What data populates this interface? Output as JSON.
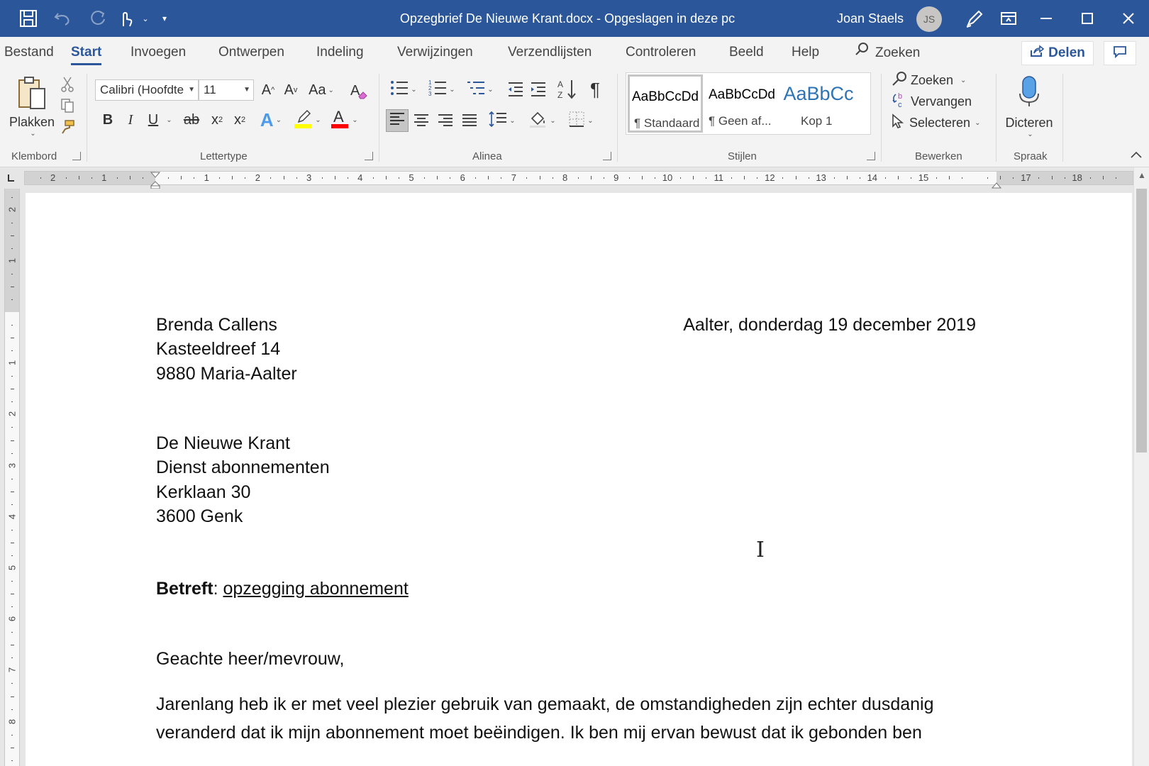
{
  "window": {
    "title": "Opzegbrief De Nieuwe Krant.docx  -  Opgeslagen in deze pc",
    "user_name": "Joan Staels",
    "user_initials": "JS",
    "accent_color": "#2b579a"
  },
  "tabs": [
    {
      "label": "Bestand"
    },
    {
      "label": "Start"
    },
    {
      "label": "Invoegen"
    },
    {
      "label": "Ontwerpen"
    },
    {
      "label": "Indeling"
    },
    {
      "label": "Verwijzingen"
    },
    {
      "label": "Verzendlijsten"
    },
    {
      "label": "Controleren"
    },
    {
      "label": "Beeld"
    },
    {
      "label": "Help"
    }
  ],
  "active_tab": "Start",
  "tell_me": "Zoeken",
  "share_label": "Delen",
  "ribbon": {
    "clipboard": {
      "paste_label": "Plakken",
      "group_label": "Klembord"
    },
    "font": {
      "name": "Calibri (Hoofdte",
      "size": "11",
      "group_label": "Lettertype",
      "grow": "A",
      "shrink": "A",
      "case": "Aa",
      "bold": "B",
      "italic": "I",
      "underline": "U",
      "strike": "ab",
      "subscript": "x",
      "superscript": "x",
      "effect": "A",
      "highlight_color": "#ffff00",
      "font_color": "#ff0000"
    },
    "paragraph": {
      "group_label": "Alinea",
      "pilcrow": "¶"
    },
    "styles": {
      "group_label": "Stijlen",
      "items": [
        {
          "preview": "AaBbCcDd",
          "name": "¶ Standaard"
        },
        {
          "preview": "AaBbCcDd",
          "name": "¶ Geen af..."
        },
        {
          "preview": "AaBbCc",
          "name": "Kop 1"
        }
      ]
    },
    "editing": {
      "group_label": "Bewerken",
      "find": "Zoeken",
      "replace": "Vervangen",
      "select": "Selecteren"
    },
    "voice": {
      "group_label": "Spraak",
      "dictate": "Dicteren"
    }
  },
  "ruler": {
    "h_left_numbers": [
      "2",
      "1"
    ],
    "h_numbers": [
      "1",
      "2",
      "3",
      "4",
      "5",
      "6",
      "7",
      "8",
      "9",
      "10",
      "11",
      "12",
      "13",
      "14",
      "15"
    ],
    "h_right_numbers": [
      "17",
      "18"
    ],
    "v_top_numbers": [
      "2",
      "1"
    ],
    "v_numbers": [
      "1",
      "2",
      "3",
      "4",
      "5",
      "6",
      "7",
      "8"
    ]
  },
  "document": {
    "sender": [
      "Brenda Callens",
      "Kasteeldreef 14",
      "9880 Maria-Aalter"
    ],
    "date_line": "Aalter, donderdag 19 december 2019",
    "recipient": [
      "De Nieuwe Krant",
      "Dienst abonnementen",
      "Kerklaan 30",
      "3600 Genk"
    ],
    "subject_label": "Betreft",
    "subject_sep": ": ",
    "subject_text": "opzegging abonnement",
    "salutation": "Geachte heer/mevrouw,",
    "body_lines": [
      "Jarenlang heb ik er met veel plezier gebruik van gemaakt, de omstandigheden zijn echter dusdanig",
      "veranderd dat ik mijn abonnement moet beëindigen. Ik ben mij ervan bewust dat ik gebonden ben"
    ]
  }
}
